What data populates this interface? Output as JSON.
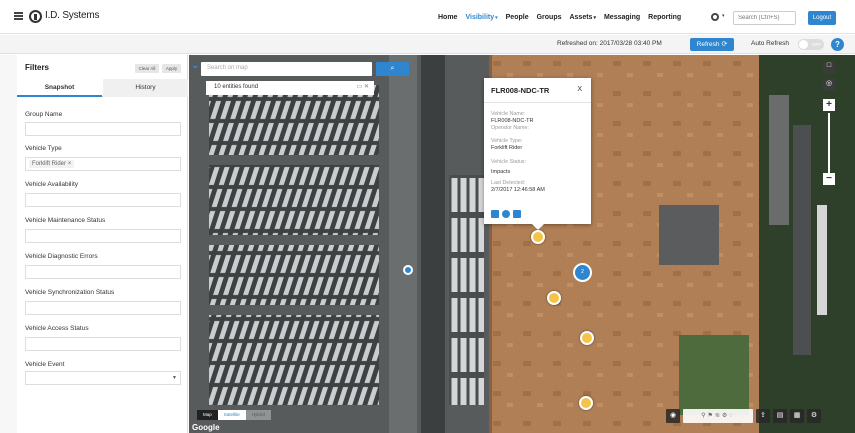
{
  "app": {
    "logo": "I.D. Systems"
  },
  "nav": {
    "items": [
      {
        "label": "Home"
      },
      {
        "label": "Visibility",
        "caret": true,
        "active": true
      },
      {
        "label": "People"
      },
      {
        "label": "Groups"
      },
      {
        "label": "Assets",
        "caret": true
      },
      {
        "label": "Messaging"
      },
      {
        "label": "Reporting"
      }
    ],
    "search_placeholder": "Search (Ctrl+S)",
    "logout": "Logout"
  },
  "subbar": {
    "refreshed": "Refreshed on: 2017/03/28 03:40 PM",
    "refresh": "Refresh",
    "auto_refresh": "Auto Refresh",
    "toggle": "OFF",
    "help": "?"
  },
  "filters": {
    "title": "Filters",
    "clear_all": "Clear All",
    "apply": "Apply",
    "tabs": [
      "Snapshot",
      "History"
    ],
    "fields": [
      {
        "label": "Group Name"
      },
      {
        "label": "Vehicle Type",
        "chip": "Forklift Rider"
      },
      {
        "label": "Vehicle Availability"
      },
      {
        "label": "Vehicle Maintenance Status"
      },
      {
        "label": "Vehicle Diagnostic Errors"
      },
      {
        "label": "Vehicle Synchronization Status"
      },
      {
        "label": "Vehicle Access Status"
      },
      {
        "label": "Vehicle Event",
        "select": true
      }
    ]
  },
  "map": {
    "search_placeholder": "Search on map",
    "entities_found": "10 entities found",
    "map_types": [
      "Map",
      "Satellite",
      "Hybrid"
    ],
    "attribution": "Google",
    "blue_marker_count": "2"
  },
  "popup": {
    "title": "FLR008-NDC-TR",
    "close": "X",
    "vehicle_name_label": "Vehicle Name:",
    "vehicle_name": "FLR008-NDC-TR",
    "operator_name_label": "Operator Name:",
    "vehicle_type_label": "Vehicle Type:",
    "vehicle_type": "Forklift Rider",
    "vehicle_status_label": "Vehicle Status:",
    "vehicle_status": "Impacts",
    "last_detected_label": "Last Detected:",
    "last_detected": "2/7/2017 12:46:58 AM"
  },
  "colors": {
    "accent": "#2f86cf",
    "marker": "#f4c34a"
  }
}
